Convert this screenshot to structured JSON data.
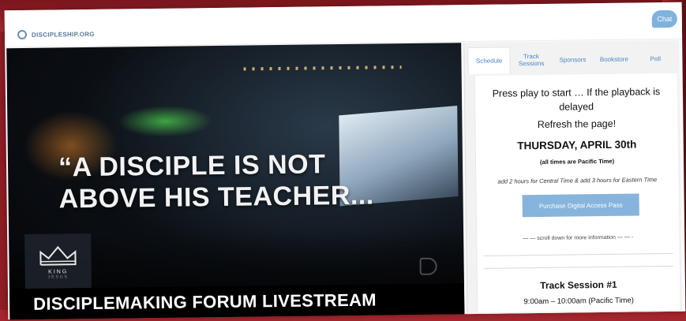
{
  "site": {
    "logo_text": "DISCIPLESHIP.ORG"
  },
  "chat": {
    "label": "Chat"
  },
  "video": {
    "quote_line1": "“A DISCIPLE  IS NOT",
    "quote_line2": "ABOVE HIS TEACHER...",
    "badge_line1": "KING",
    "badge_line2": "JESUS",
    "title": "DISCIPLEMAKING FORUM LIVESTREAM"
  },
  "tabs": [
    {
      "label": "Schedule",
      "active": true
    },
    {
      "label": "Track Sessions",
      "active": false
    },
    {
      "label": "Sponsors",
      "active": false
    },
    {
      "label": "Bookstore",
      "active": false
    },
    {
      "label": "Poll",
      "active": false
    }
  ],
  "schedule": {
    "notice": "Press play to start … If the playback is delayed",
    "refresh": "Refresh the page!",
    "date": "THURSDAY, APRIL 30th",
    "timezone_note": "(all times are Pacific Time)",
    "offset_note": "add 2 hours for Central Time & add 3 hours for Eastern Time",
    "purchase_button": "Purchase Digital Access Pass",
    "scroll_note": "— —  scroll down for more information — — -",
    "session_title": "Track Session #1",
    "session_time": "9:00am – 10:00am (Pacific Time)"
  },
  "colors": {
    "accent": "#86b4dc",
    "link": "#4a86c5",
    "backdrop": "#8e1d24"
  }
}
